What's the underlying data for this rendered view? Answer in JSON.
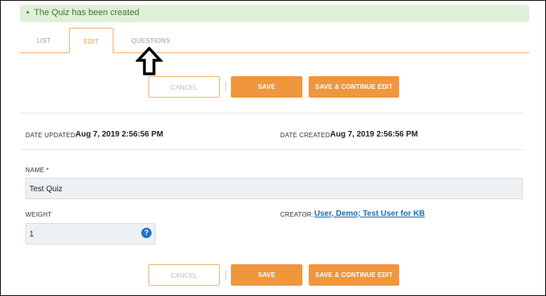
{
  "alert": {
    "bullet": "•",
    "message": "The Quiz has been created"
  },
  "tabs": {
    "list": "LIST",
    "edit": "EDIT",
    "questions": "QUESTIONS"
  },
  "buttons": {
    "cancel": "CANCEL",
    "save": "SAVE",
    "save_continue": "SAVE & CONTINUE EDIT"
  },
  "meta": {
    "date_updated_label": "DATE UPDATED:",
    "date_updated_value": "Aug 7, 2019 2:56:56 PM",
    "date_created_label": "DATE CREATED:",
    "date_created_value": "Aug 7, 2019 2:56:56 PM"
  },
  "form": {
    "name_label": "NAME *",
    "name_value": "Test Quiz",
    "weight_label": "WEIGHT",
    "weight_value": "1",
    "help_icon": "?",
    "creator_label": "CREATOR:",
    "creator_value": "User, Demo; Test User for KB"
  },
  "colors": {
    "accent": "#f0963c",
    "alert_bg": "#dff0d8",
    "link": "#1a6fb5",
    "help": "#1a73c9"
  },
  "icons": [
    "up-arrow-icon",
    "help-icon"
  ]
}
